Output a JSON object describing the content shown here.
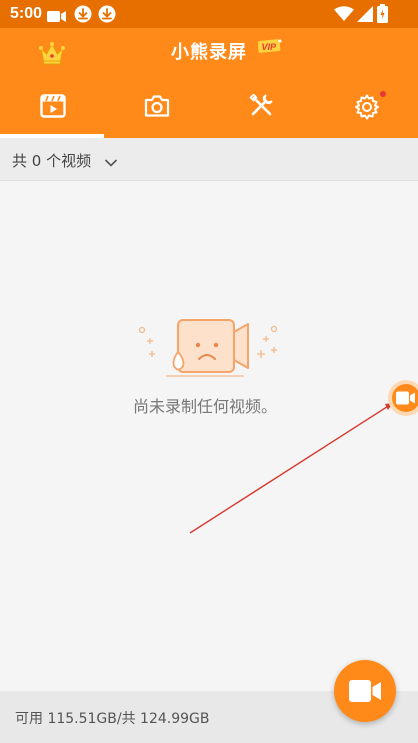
{
  "status_bar": {
    "time": "5:00",
    "icons": [
      "video-camera-icon",
      "download-icon",
      "download-icon",
      "wifi-icon",
      "signal-icon",
      "battery-icon"
    ]
  },
  "header": {
    "title": "小熊录屏",
    "vip_label": "VIP",
    "icons": [
      "crown-icon"
    ]
  },
  "tabs": [
    {
      "name": "videos",
      "icon": "video-clapper-icon",
      "active": true
    },
    {
      "name": "screenshots",
      "icon": "camera-icon",
      "active": false
    },
    {
      "name": "tools",
      "icon": "tools-icon",
      "active": false
    },
    {
      "name": "settings",
      "icon": "gear-icon",
      "active": false,
      "has_notification_dot": true
    }
  ],
  "filter": {
    "label": "共 0 个视频",
    "icon": "chevron-down-icon"
  },
  "empty_state": {
    "message": "尚未录制任何视频。",
    "icon": "sad-video-camera-icon"
  },
  "storage": {
    "text": "可用 115.51GB/共 124.99GB"
  },
  "fab": {
    "icon": "video-camera-icon"
  },
  "floating_shortcut": {
    "icon": "video-camera-icon"
  },
  "colors": {
    "primary": "#ff8a1a",
    "status_bar": "#e66f00",
    "notification": "#e53935",
    "annotation_arrow": "#d63a2f"
  }
}
